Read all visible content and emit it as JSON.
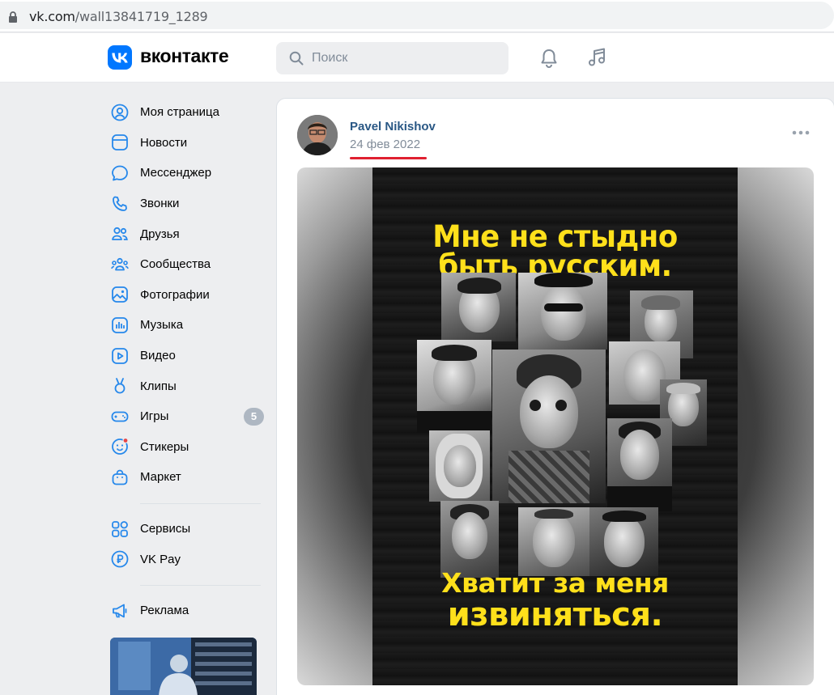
{
  "browser": {
    "url_host": "vk.com",
    "url_path": "/wall13841719_1289"
  },
  "header": {
    "logo_text": "вконтакте",
    "search_placeholder": "Поиск"
  },
  "sidebar": {
    "items": [
      {
        "label": "Моя страница",
        "icon": "user-circle-icon"
      },
      {
        "label": "Новости",
        "icon": "news-icon"
      },
      {
        "label": "Мессенджер",
        "icon": "message-icon"
      },
      {
        "label": "Звонки",
        "icon": "phone-icon"
      },
      {
        "label": "Друзья",
        "icon": "friends-icon"
      },
      {
        "label": "Сообщества",
        "icon": "communities-icon"
      },
      {
        "label": "Фотографии",
        "icon": "photos-icon"
      },
      {
        "label": "Музыка",
        "icon": "music-icon"
      },
      {
        "label": "Видео",
        "icon": "video-icon"
      },
      {
        "label": "Клипы",
        "icon": "clips-icon"
      },
      {
        "label": "Игры",
        "icon": "games-icon",
        "badge": "5"
      },
      {
        "label": "Стикеры",
        "icon": "stickers-icon"
      },
      {
        "label": "Маркет",
        "icon": "market-icon"
      }
    ],
    "items2": [
      {
        "label": "Сервисы",
        "icon": "services-icon"
      },
      {
        "label": "VK Pay",
        "icon": "vkpay-icon"
      }
    ],
    "items3": [
      {
        "label": "Реклама",
        "icon": "megaphone-icon"
      }
    ]
  },
  "post": {
    "author": "Pavel Nikishov",
    "date": "24 фев 2022",
    "poster_top_line1": "Мне не стыдно",
    "poster_top_line2": "быть русским.",
    "poster_bottom_line1": "Хватит за меня",
    "poster_bottom_line2": "извиняться."
  },
  "colors": {
    "accent": "#0077ff",
    "link": "#2a5885",
    "poster_text": "#ffe01b",
    "highlight_underline": "#e02030"
  }
}
